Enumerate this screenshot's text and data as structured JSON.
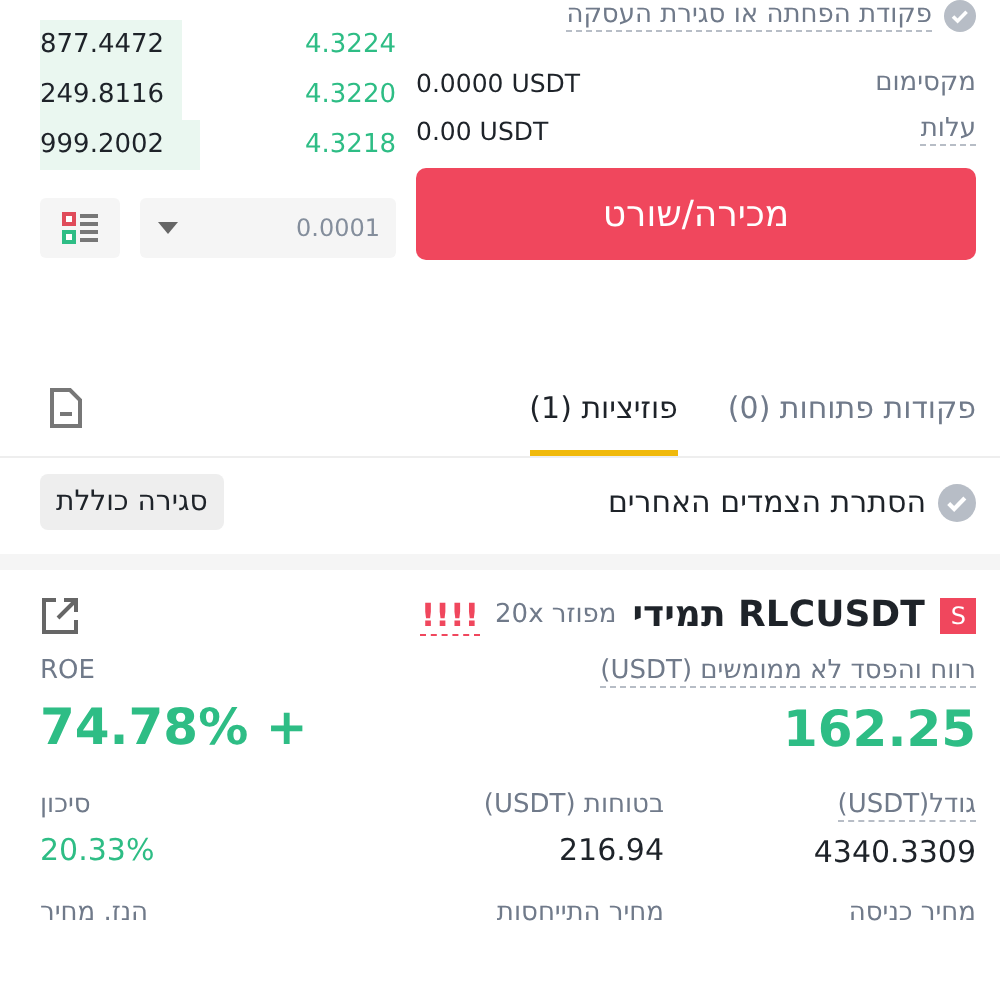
{
  "order_book": {
    "rows": [
      {
        "amount": "877.4472",
        "price": "4.3224"
      },
      {
        "amount": "249.8116",
        "price": "4.3220"
      },
      {
        "amount": "999.2002",
        "price": "4.3218"
      }
    ],
    "tick_size": "0.0001"
  },
  "order_form": {
    "reduce_only": {
      "label": "פקודת הפחתה או סגירת העסקה",
      "checked": true
    },
    "info": [
      {
        "label": "מקסימום",
        "value": "0.0000 USDT",
        "dotted": false
      },
      {
        "label": "עלות",
        "value": "0.00 USDT",
        "dotted": true
      }
    ],
    "submit": "מכירה/שורט"
  },
  "tabs": [
    {
      "label": "פקודות פתוחות (0)",
      "selected": false
    },
    {
      "label": "פוזיציות (1)",
      "selected": true
    }
  ],
  "hide_others": {
    "label": "הסתרת הצמדים האחרים",
    "checked": true
  },
  "close_all": "סגירה כוללת",
  "position": {
    "side": "S",
    "symbol": "RLCUSDT תמידי",
    "margin": "מפוזר 20x",
    "warning": "!!!!",
    "pnl_label": "רווח והפסד לא ממומשים (USDT)",
    "pnl": "162.25",
    "roe_label": "ROE",
    "roe": "74.78% +",
    "stats": [
      {
        "label": "גודל(USDT)",
        "value": "4340.3309",
        "color": "#1e2329",
        "dotted": true
      },
      {
        "label": "בטוחות (USDT)",
        "value": "216.94",
        "color": "#1e2329",
        "dotted": false
      },
      {
        "label": "סיכון",
        "value": "20.33%",
        "color": "#2ebd85",
        "dotted": false
      }
    ],
    "more_labels": [
      "מחיר כניסה",
      "מחיר התייחסות",
      "הנז. מחיר"
    ]
  }
}
